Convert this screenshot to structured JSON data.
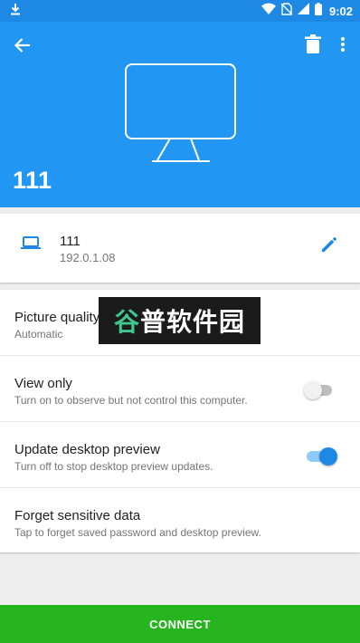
{
  "status_bar": {
    "time": "9:02",
    "icons": [
      "download-icon",
      "wifi-icon",
      "no-sim-icon",
      "signal-icon",
      "battery-icon"
    ]
  },
  "header": {
    "title": "111",
    "background": "#2196f3",
    "icons": [
      "back-arrow-icon",
      "trash-icon",
      "more-vert-icon",
      "monitor-icon"
    ]
  },
  "device": {
    "name": "111",
    "address": "192.0.1.08",
    "icons": [
      "laptop-icon",
      "edit-pencil-icon"
    ]
  },
  "settings": {
    "picture_quality": {
      "title": "Picture quality",
      "subtitle": "Automatic"
    },
    "view_only": {
      "title": "View only",
      "subtitle": "Turn on to observe but not control this computer.",
      "enabled": false
    },
    "update_preview": {
      "title": "Update desktop preview",
      "subtitle": "Turn off to stop desktop preview updates.",
      "enabled": true
    },
    "forget": {
      "title": "Forget sensitive data",
      "subtitle": "Tap to forget saved password and desktop preview."
    }
  },
  "watermark": {
    "text_accent": "谷",
    "text": "普软件园"
  },
  "connect_button": {
    "label": "CONNECT",
    "color": "#26b51f"
  }
}
